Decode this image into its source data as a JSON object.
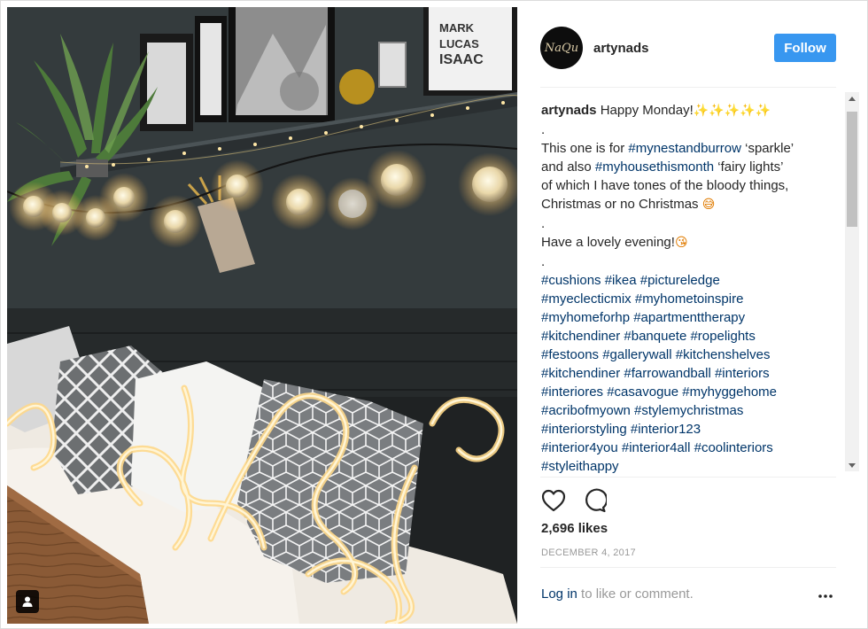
{
  "post": {
    "username": "artynads",
    "avatar_text": "NaQu",
    "follow_label": "Follow",
    "caption": {
      "username": "artynads",
      "line1_text": "Happy Monday!",
      "line1_emoji": "✨✨✨✨✨",
      "line2": ".",
      "line3_pre": "This one is for ",
      "line3_tag": "#mynestandburrow",
      "line3_post": " ‘sparkle’",
      "line4_pre": "and also ",
      "line4_tag": "#myhousethismonth",
      "line4_post": " ‘fairy lights’",
      "line5": "of which I have tones of the bloody things,",
      "line6_text": "Christmas or no Christmas ",
      "line6_emoji": "😅",
      "line7": ".",
      "line8_text": "Have a lovely evening!",
      "line8_emoji": "😘",
      "line9": ".",
      "hashtag_lines": [
        "#cushions #ikea #pictureledge",
        "#myeclecticmix #myhometoinspire",
        "#myhomeforhp #apartmenttherapy",
        "#kitchendiner #banquete #ropelights",
        "#festoons #gallerywall #kitchenshelves",
        "#kitchendiner #farrowandball #interiors",
        "#interiores #casavogue #myhyggehome",
        "#acribofmyown #stylemychristmas",
        "#interiorstyling #interior123",
        "#interior4you #interior4all #coolinteriors",
        "#styleithappy"
      ]
    },
    "likes": "2,696 likes",
    "date": "DECEMBER 4, 2017",
    "login_link": "Log in",
    "login_rest": " to like or comment.",
    "more_label": "•••"
  },
  "icons": {
    "like": "heart-icon",
    "comment": "comment-icon",
    "more": "more-options-icon",
    "user_tag": "user-tag-icon"
  },
  "colors": {
    "accent": "#3897f0",
    "link": "#003569",
    "muted": "#999999",
    "text": "#262626"
  }
}
